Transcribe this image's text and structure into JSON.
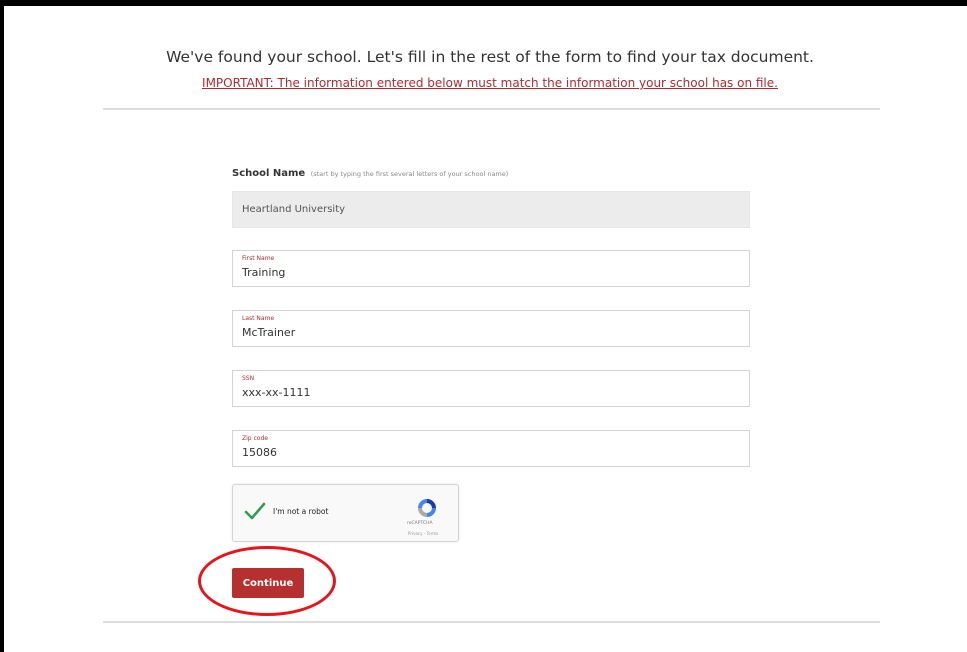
{
  "header": {
    "title": "We've found your school. Let's fill in the rest of the form to find your tax document.",
    "important": "IMPORTANT: The information entered below must match the information your school has on file."
  },
  "form": {
    "school": {
      "label": "School Name",
      "hint": "(start by typing the first several letters of your school name)",
      "value": "Heartland University"
    },
    "first_name": {
      "label": "First Name",
      "value": "Training"
    },
    "last_name": {
      "label": "Last Name",
      "value": "McTrainer"
    },
    "ssn": {
      "label": "SSN",
      "value": "xxx-xx-1111"
    },
    "zip": {
      "label": "Zip code",
      "value": "15086"
    },
    "recaptcha": {
      "label": "I'm not a robot",
      "brand": "reCAPTCHA",
      "terms": "Privacy - Terms",
      "checked": true
    },
    "continue_label": "Continue"
  },
  "colors": {
    "accent": "#b6302f",
    "important_text": "#b02a30",
    "highlight": "#e8141c",
    "check": "#2e9e4f"
  }
}
